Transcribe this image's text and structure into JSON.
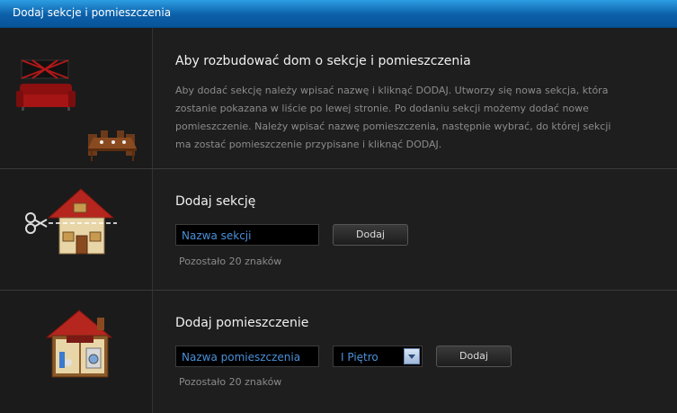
{
  "window": {
    "title": "Dodaj sekcje i pomieszczenia"
  },
  "intro": {
    "icon": "furniture-icon",
    "heading": "Aby rozbudować dom o sekcje i pomieszczenia",
    "lines": [
      "Aby dodać sekcję należy wpisać nazwę i kliknąć DODAJ. Utworzy się nowa sekcja, która",
      "zostanie pokazana w liście po lewej stronie. Po dodaniu sekcji możemy dodać nowe",
      "pomieszczenie. Należy wpisać nazwę pomieszczenia, następnie wybrać, do której sekcji",
      "ma zostać pomieszczenie przypisane i kliknąć DODAJ."
    ]
  },
  "section": {
    "icon": "house-cut-icon",
    "heading": "Dodaj sekcję",
    "input_value": "Nazwa sekcji",
    "button": "Dodaj",
    "remaining": "Pozostało 20 znaków"
  },
  "room": {
    "icon": "house-rooms-icon",
    "heading": "Dodaj pomieszczenie",
    "input_value": "Nazwa pomieszczenia",
    "select_value": "I Piętro",
    "button": "Dodaj",
    "remaining": "Pozostało 20 znaków"
  },
  "colors": {
    "accent": "#0b5fa8",
    "input_text": "#4a90d9"
  }
}
